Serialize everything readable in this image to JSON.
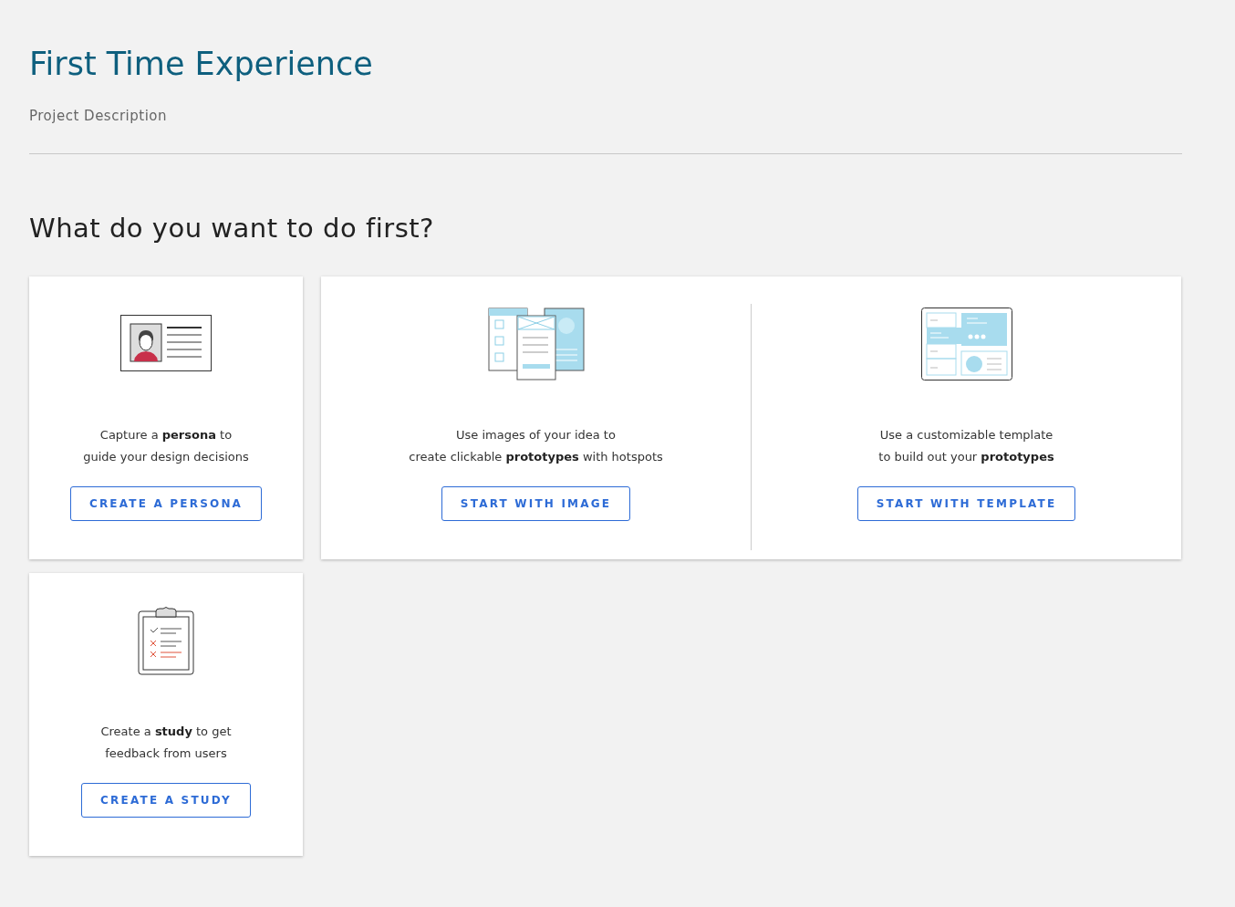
{
  "title": "First Time Experience",
  "description": "Project Description",
  "heading": "What do you want to do first?",
  "cards": [
    {
      "options": [
        {
          "kind": "persona",
          "text": "Capture a **persona** to\nguide your design decisions",
          "button": "CREATE A PERSONA"
        }
      ]
    },
    {
      "options": [
        {
          "kind": "image",
          "text": "Use images of your idea to\ncreate clickable **prototypes** with hotspots",
          "button": "START WITH IMAGE"
        },
        {
          "kind": "template",
          "text": "Use a customizable template\nto build out your **prototypes**",
          "button": "START WITH TEMPLATE"
        }
      ]
    },
    {
      "options": [
        {
          "kind": "study",
          "text": "Create a **study** to get\nfeedback from users",
          "button": "CREATE A STUDY"
        }
      ]
    }
  ]
}
